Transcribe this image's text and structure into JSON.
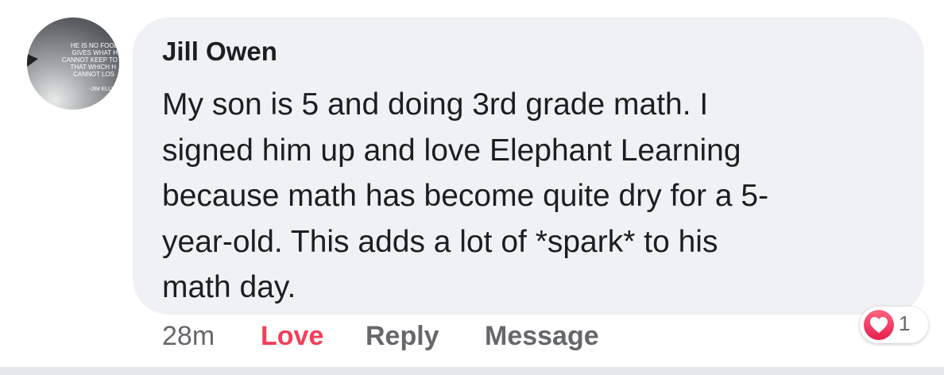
{
  "comment": {
    "avatar_quote_lines": [
      "HE IS NO FOOL",
      "GIVES WHAT H",
      "CANNOT KEEP TO",
      "THAT WHICH H",
      "CANNOT LOS",
      "-JIM ELLI"
    ],
    "author": "Jill Owen",
    "body_lines": [
      "My son is 5 and doing 3rd grade math. I",
      "signed him up and love Elephant Learning",
      "because math has become quite dry for a 5-",
      "year-old. This adds a lot of *spark* to his",
      "math day."
    ]
  },
  "actions": {
    "time": "28m",
    "love": "Love",
    "reply": "Reply",
    "message": "Message"
  },
  "reaction": {
    "icon": "heart-icon",
    "count": "1"
  },
  "colors": {
    "bubble_bg": "#f0f1f4",
    "love_active": "#f33e58",
    "secondary_text": "#65676b"
  }
}
